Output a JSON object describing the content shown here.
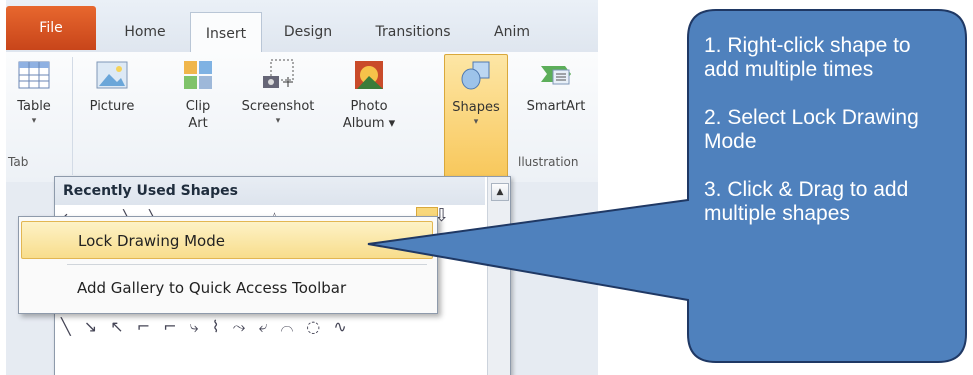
{
  "tabs": [
    "File",
    "Home",
    "Insert",
    "Design",
    "Transitions",
    "Anim"
  ],
  "active_tab": "Insert",
  "ribbon": {
    "table": {
      "label": "Table",
      "arrow": "▾"
    },
    "picture": {
      "label": "Picture"
    },
    "clipart": {
      "label": "Clip\nArt"
    },
    "screenshot": {
      "label": "Screenshot",
      "arrow": "▾"
    },
    "photo_album": {
      "label": "Photo\nAlbum ▾"
    },
    "shapes": {
      "label": "Shapes",
      "arrow": "▾"
    },
    "smartart": {
      "label": "SmartArt"
    },
    "group_tables": "Tab",
    "group_illustrations": "llustration"
  },
  "dropdown": {
    "header": "Recently Used Shapes",
    "top_shapes": "⇋ ▭ ╲ ╲ ▭ ▭ ▭ ☆ ▭ ▭",
    "bottom_shapes": "╲ ↘ ↖ ⌐ ⌐ ⤷ ⌇ ⤳ ⤶ ⌒ ◌ ∿"
  },
  "context_menu": {
    "items": [
      "Lock Drawing Mode",
      "Add Gallery to Quick Access Toolbar"
    ]
  },
  "callout": {
    "lines": [
      "1. Right-click shape to add multiple times",
      "2. Select Lock Drawing Mode",
      "3. Click & Drag to add multiple shapes"
    ],
    "fill": "#4f81bd",
    "border": "#1f3864"
  }
}
